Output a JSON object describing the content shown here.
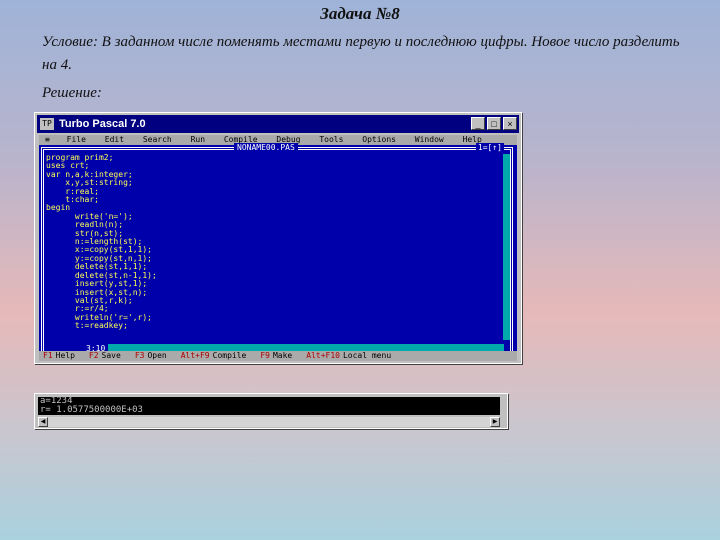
{
  "slide": {
    "title": "Задача №8",
    "condition": "Условие: В заданном числе поменять местами первую и последнюю цифры. Новое число разделить на 4.",
    "solution_label": "Решение:"
  },
  "ide": {
    "window_title": "Turbo Pascal 7.0",
    "controls": [
      "_",
      "□",
      "×"
    ],
    "menu": [
      "≡",
      "File",
      "Edit",
      "Search",
      "Run",
      "Compile",
      "Debug",
      "Tools",
      "Options",
      "Window",
      "Help"
    ],
    "filename": "NONAME00.PAS",
    "corner_indicator": "1=[↑]",
    "cursor_pos": "3:10",
    "code_lines": [
      "program prim2;",
      "uses crt;",
      "var n,a,k:integer;",
      "    x,y,st:string;",
      "    r:real;",
      "    t:char;",
      "begin",
      "      write('n=');",
      "      readln(n);",
      "      str(n,st);",
      "      n:=length(st);",
      "      x:=copy(st,1,1);",
      "      y:=copy(st,n,1);",
      "      delete(st,1,1);",
      "      delete(st,n-1,1);",
      "      insert(y,st,1);",
      "      insert(x,st,n);",
      "      val(st,r,k);",
      "      r:=r/4;",
      "      writeln('r=',r);",
      "      t:=readkey;"
    ],
    "status": [
      {
        "key": "F1",
        "label": "Help"
      },
      {
        "key": "F2",
        "label": "Save"
      },
      {
        "key": "F3",
        "label": "Open"
      },
      {
        "key": "Alt+F9",
        "label": "Compile"
      },
      {
        "key": "F9",
        "label": "Make"
      },
      {
        "key": "Alt+F10",
        "label": "Local menu"
      }
    ]
  },
  "output": {
    "lines": [
      "a=1234",
      "r= 1.0577500000E+03"
    ]
  }
}
